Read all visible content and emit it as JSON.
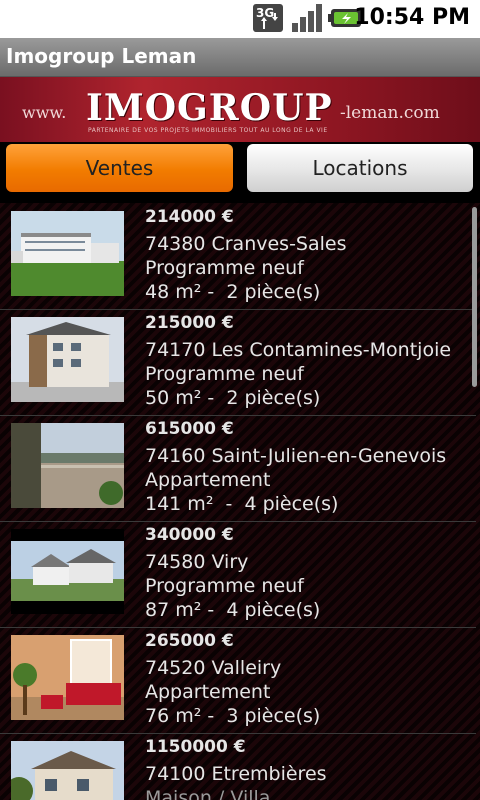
{
  "status_bar": {
    "network": "3G",
    "time": "10:54 PM",
    "icons": [
      "3g-data-icon",
      "signal-bars-icon",
      "battery-charging-icon"
    ]
  },
  "app": {
    "title": "Imogroup Leman"
  },
  "banner": {
    "prefix": "www.",
    "brand": "IMOGROUP",
    "suffix": "-leman.com",
    "tagline": "PARTENAIRE DE VOS PROJETS IMMOBILIERS TOUT AU LONG DE LA VIE"
  },
  "tabs": [
    {
      "label": "Ventes",
      "selected": true
    },
    {
      "label": "Locations",
      "selected": false
    }
  ],
  "listings": [
    {
      "price": "214000 €",
      "city": "74380 Cranves-Sales",
      "type": "Programme neuf",
      "details": "48 m² -  2 pièce(s)",
      "photo": "modern-apartment-building-photo"
    },
    {
      "price": "215000 €",
      "city": "74170 Les Contamines-Montjoie",
      "type": "Programme neuf",
      "details": "50 m² -  2 pièce(s)",
      "photo": "chalet-building-photo"
    },
    {
      "price": "615000 €",
      "city": "74160 Saint-Julien-en-Genevois",
      "type": "Appartement",
      "details": "141 m²  -  4 pièce(s)",
      "photo": "terrace-view-photo"
    },
    {
      "price": "340000 €",
      "city": "74580 Viry",
      "type": "Programme neuf",
      "details": "87 m² -  4 pièce(s)",
      "photo": "residential-houses-photo"
    },
    {
      "price": "265000 €",
      "city": "74520 Valleiry",
      "type": "Appartement",
      "details": "76 m² -  3 pièce(s)",
      "photo": "living-room-photo"
    },
    {
      "price": "1150000 €",
      "city": "74100 Etrembières",
      "type": "Maison / Villa",
      "details": "",
      "photo": "house-exterior-photo"
    }
  ],
  "colors": {
    "accent_orange": "#f27c00",
    "banner_red": "#b0242e",
    "title_gray": "#7d7d7d"
  }
}
